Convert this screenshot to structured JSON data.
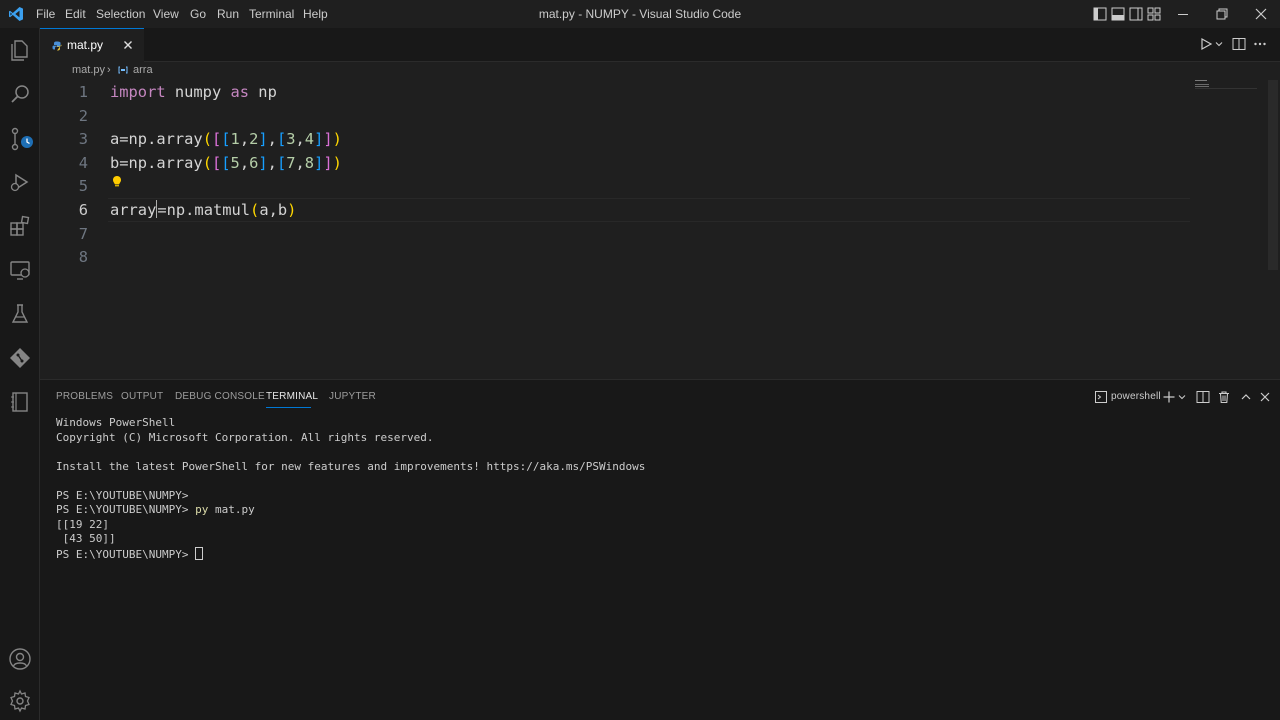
{
  "window": {
    "title": "mat.py - NUMPY - Visual Studio Code",
    "menu": [
      "File",
      "Edit",
      "Selection",
      "View",
      "Go",
      "Run",
      "Terminal",
      "Help"
    ]
  },
  "activity_bar": {
    "items": [
      "explorer-icon",
      "search-icon",
      "source-control-icon",
      "run-debug-icon",
      "extensions-icon",
      "remote-explorer-icon",
      "testing-icon",
      "git-icon",
      "notebook-icon",
      "account-icon",
      "settings-gear-icon"
    ]
  },
  "editor": {
    "tab": {
      "label": "mat.py"
    },
    "breadcrumb": {
      "file": "mat.py",
      "symbol": "arra"
    },
    "line_numbers": [
      "1",
      "2",
      "3",
      "4",
      "5",
      "6",
      "7",
      "8"
    ],
    "current_line": 6,
    "lines": [
      [
        {
          "t": "import",
          "c": "kw"
        },
        {
          "t": " numpy ",
          "c": "id"
        },
        {
          "t": "as",
          "c": "kw"
        },
        {
          "t": " np",
          "c": "id"
        }
      ],
      [],
      [
        {
          "t": "a=np.",
          "c": "id"
        },
        {
          "t": "array",
          "c": "id"
        },
        {
          "t": "(",
          "c": "b1"
        },
        {
          "t": "[",
          "c": "b2"
        },
        {
          "t": "[",
          "c": "b3"
        },
        {
          "t": "1",
          "c": "num"
        },
        {
          "t": ",",
          "c": "id"
        },
        {
          "t": "2",
          "c": "num"
        },
        {
          "t": "]",
          "c": "b3"
        },
        {
          "t": ",",
          "c": "id"
        },
        {
          "t": "[",
          "c": "b3"
        },
        {
          "t": "3",
          "c": "num"
        },
        {
          "t": ",",
          "c": "id"
        },
        {
          "t": "4",
          "c": "num"
        },
        {
          "t": "]",
          "c": "b3"
        },
        {
          "t": "]",
          "c": "b2"
        },
        {
          "t": ")",
          "c": "b1"
        }
      ],
      [
        {
          "t": "b=np.",
          "c": "id"
        },
        {
          "t": "array",
          "c": "id"
        },
        {
          "t": "(",
          "c": "b1"
        },
        {
          "t": "[",
          "c": "b2"
        },
        {
          "t": "[",
          "c": "b3"
        },
        {
          "t": "5",
          "c": "num"
        },
        {
          "t": ",",
          "c": "id"
        },
        {
          "t": "6",
          "c": "num"
        },
        {
          "t": "]",
          "c": "b3"
        },
        {
          "t": ",",
          "c": "id"
        },
        {
          "t": "[",
          "c": "b3"
        },
        {
          "t": "7",
          "c": "num"
        },
        {
          "t": ",",
          "c": "id"
        },
        {
          "t": "8",
          "c": "num"
        },
        {
          "t": "]",
          "c": "b3"
        },
        {
          "t": "]",
          "c": "b2"
        },
        {
          "t": ")",
          "c": "b1"
        }
      ],
      [],
      [
        {
          "t": "array",
          "c": "id"
        },
        {
          "t": "=np.",
          "c": "id"
        },
        {
          "t": "matmul",
          "c": "id"
        },
        {
          "t": "(",
          "c": "b1"
        },
        {
          "t": "a,b",
          "c": "id"
        },
        {
          "t": ")",
          "c": "b1"
        }
      ],
      [],
      []
    ]
  },
  "panel": {
    "tabs": [
      "PROBLEMS",
      "OUTPUT",
      "DEBUG CONSOLE",
      "TERMINAL",
      "JUPYTER"
    ],
    "active_tab": "TERMINAL",
    "shell_label": "powershell",
    "terminal_lines": [
      "Windows PowerShell",
      "Copyright (C) Microsoft Corporation. All rights reserved.",
      "",
      "Install the latest PowerShell for new features and improvements! https://aka.ms/PSWindows",
      "",
      "PS E:\\YOUTUBE\\NUMPY>",
      "PS E:\\YOUTUBE\\NUMPY> py mat.py",
      "[[19 22]",
      " [43 50]]",
      "PS E:\\YOUTUBE\\NUMPY> "
    ],
    "command_highlight": {
      "line": 6,
      "prefix": "PS E:\\YOUTUBE\\NUMPY> ",
      "cmd": "py",
      "rest": " mat.py"
    }
  },
  "colors": {
    "accent": "#0078d4",
    "background": "#1f1f1f",
    "panel_background": "#181818"
  }
}
